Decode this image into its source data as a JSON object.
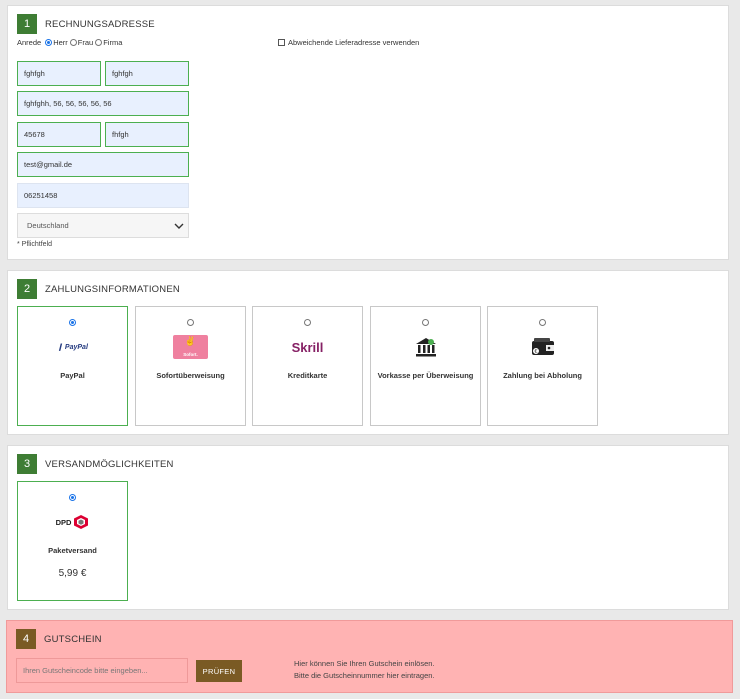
{
  "billing": {
    "step": "1",
    "title": "RECHNUNGSADRESSE",
    "salutation_label": "Anrede",
    "salutation_options": [
      "Herr",
      "Frau",
      "Firma"
    ],
    "alt_delivery_label": "Abweichende Lieferadresse verwenden",
    "first_name": "fghfgh",
    "last_name": "fghfgh",
    "street": "fghfghh, 56, 56, 56, 56, 56",
    "zip": "45678",
    "city": "fhfgh",
    "email": "test@gmail.de",
    "phone": "06251458",
    "country": "Deutschland",
    "required_note": "* Pflichtfeld"
  },
  "payment": {
    "step": "2",
    "title": "ZAHLUNGSINFORMATIONEN",
    "options": [
      {
        "label": "PayPal",
        "logo": "PayPal",
        "selected": true
      },
      {
        "label": "Sofortüberweisung",
        "logo": "Sofort.",
        "selected": false
      },
      {
        "label": "Kreditkarte",
        "logo": "Skrill",
        "selected": false
      },
      {
        "label": "Vorkasse per Überweisung",
        "logo": "bank-icon",
        "selected": false
      },
      {
        "label": "Zahlung bei Abholung",
        "logo": "wallet-icon",
        "selected": false
      }
    ]
  },
  "shipping": {
    "step": "3",
    "title": "VERSANDMÖGLICHKEITEN",
    "options": [
      {
        "label": "Paketversand",
        "logo": "DPD",
        "price": "5,99 €",
        "selected": true
      }
    ]
  },
  "coupon": {
    "step": "4",
    "title": "GUTSCHEIN",
    "placeholder": "Ihren Gutscheincode bitte eingeben...",
    "button_label": "PRÜFEN",
    "hint_line1": "Hier können Sie Ihren Gutschein einlösen.",
    "hint_line2": "Bitte die Gutscheinnummer hier eintragen."
  },
  "colors": {
    "step_green": "#3e7d34",
    "step_brown": "#7a5a24",
    "field_valid_border": "#4caf50",
    "coupon_bg": "#ffb3b3"
  }
}
